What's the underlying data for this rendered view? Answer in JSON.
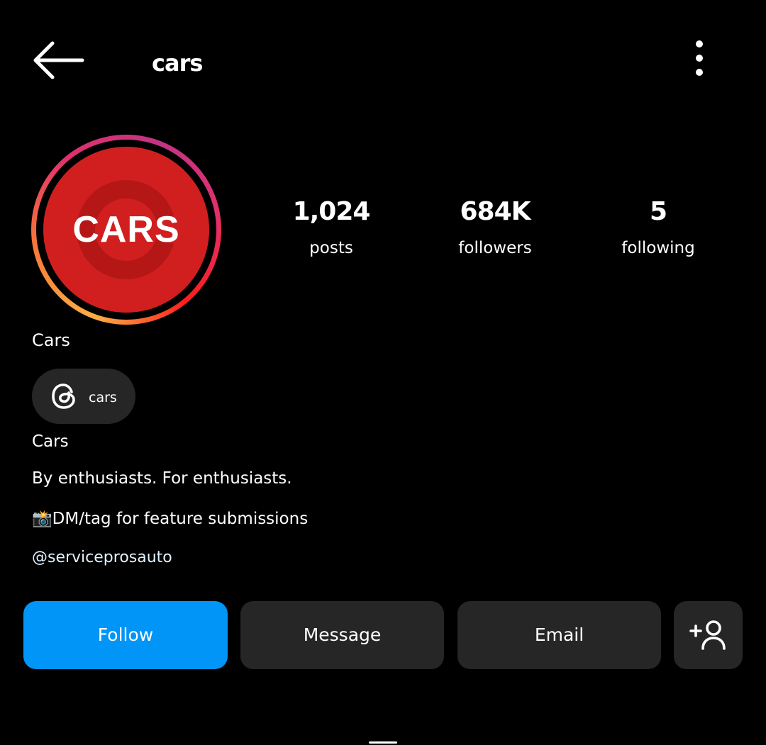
{
  "header": {
    "title": "cars",
    "back_icon": "arrow-left-icon",
    "menu_icon": "more-vertical-icon"
  },
  "profile": {
    "avatar_text": "CARS",
    "avatar_color": "#d11f1f",
    "stats": [
      {
        "value": "1,024",
        "label": "posts"
      },
      {
        "value": "684K",
        "label": "followers"
      },
      {
        "value": "5",
        "label": "following"
      }
    ],
    "display_name": "Cars",
    "threads": {
      "icon": "threads-icon",
      "label": "cars"
    },
    "bio": [
      "Cars",
      "By enthusiasts. For enthusiasts.",
      "📸DM/tag for feature submissions"
    ],
    "link": "@serviceprosauto"
  },
  "actions": {
    "follow": "Follow",
    "message": "Message",
    "email": "Email",
    "add_user_icon": "add-user-icon"
  },
  "colors": {
    "follow_button": "#0095f6",
    "secondary_button": "#262626",
    "background": "#000000"
  }
}
